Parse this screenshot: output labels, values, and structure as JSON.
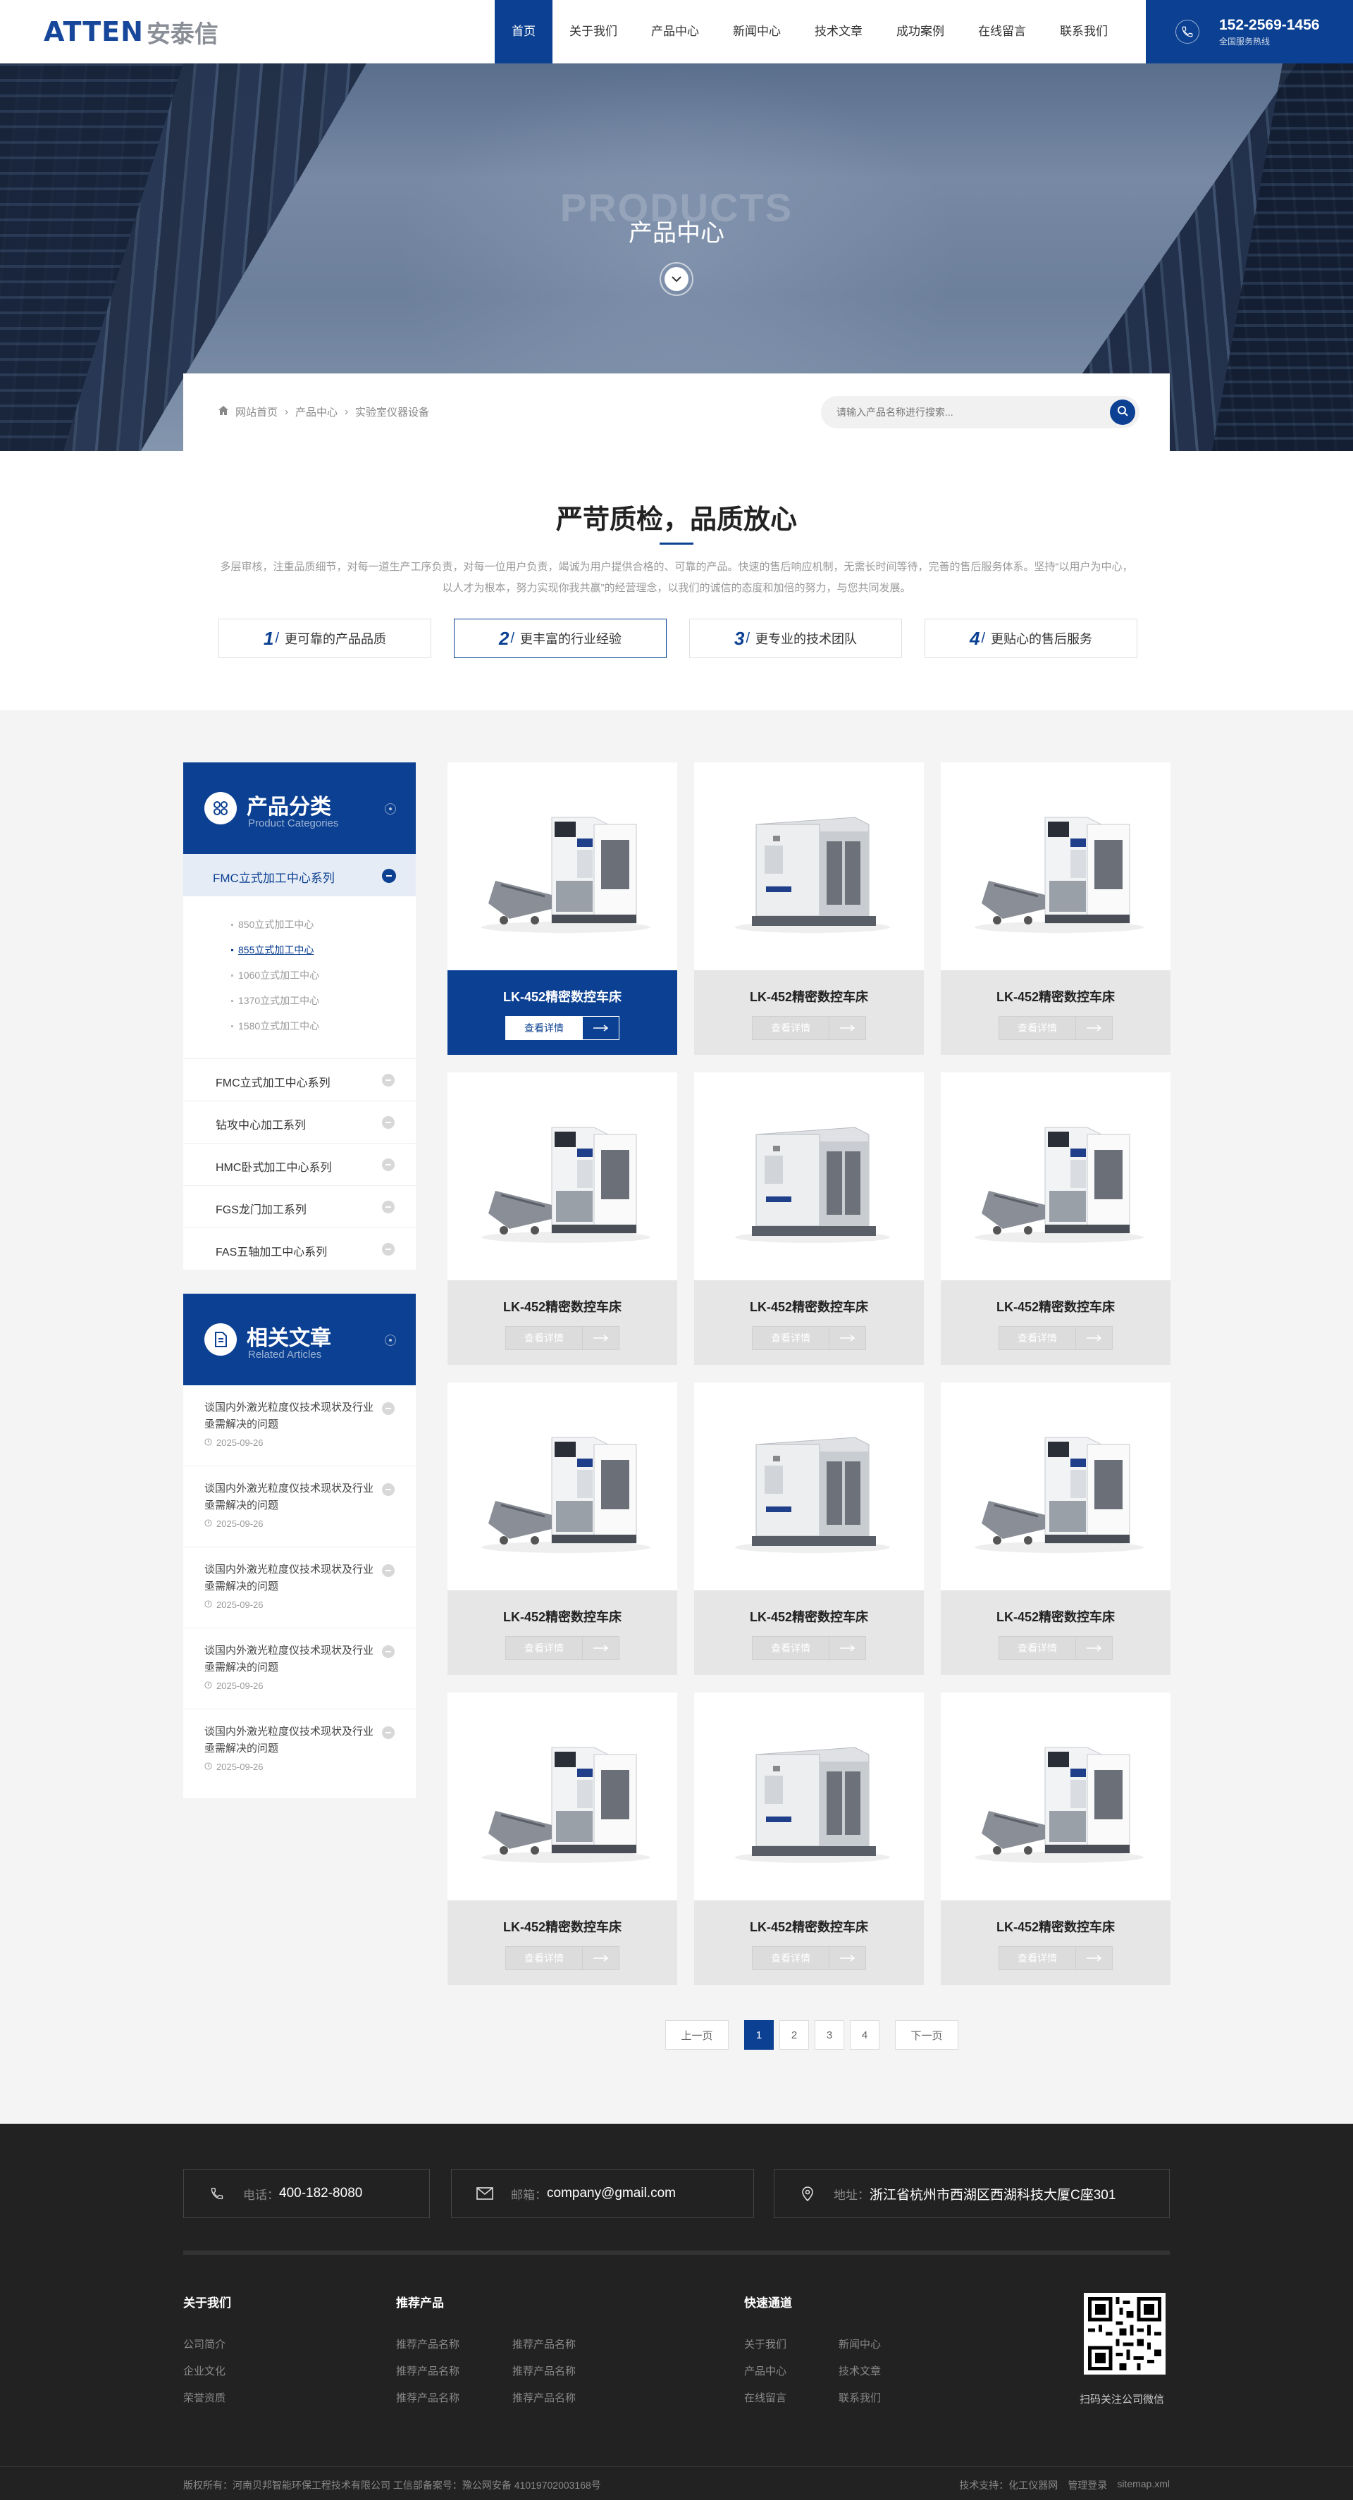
{
  "header": {
    "logo_en": "ATTEN",
    "logo_cn": "安泰信",
    "nav": [
      "首页",
      "关于我们",
      "产品中心",
      "新闻中心",
      "技术文章",
      "成功案例",
      "在线留言",
      "联系我们"
    ],
    "phone": "152-2569-1456",
    "phone_sub": "全国服务热线"
  },
  "banner": {
    "en": "PRODUCTS",
    "cn": "产品中心"
  },
  "breadcrumb": [
    "网站首页",
    "产品中心",
    "实验室仪器设备"
  ],
  "search": {
    "placeholder": "请输入产品名称进行搜索..."
  },
  "quality": {
    "title": "严苛质检，品质放心",
    "desc": "多层审核，注重品质细节，对每一道生产工序负责，对每一位用户负责，竭诚为用户提供合格的、可靠的产品。快速的售后响应机制，无需长时间等待，完善的售后服务体系。坚持“以用户为中心，以人才为根本，努力实现你我共赢”的经营理念，以我们的诚信的态度和加倍的努力，与您共同发展。",
    "items": [
      {
        "num": "1",
        "label": "更可靠的产品品质"
      },
      {
        "num": "2",
        "label": "更丰富的行业经验"
      },
      {
        "num": "3",
        "label": "更专业的技术团队"
      },
      {
        "num": "4",
        "label": "更贴心的售后服务"
      }
    ]
  },
  "sidebar": {
    "cat_title": "产品分类",
    "cat_sub": "Product Categories",
    "active_cat": "FMC立式加工中心系列",
    "sub_items": [
      "850立式加工中心",
      "855立式加工中心",
      "1060立式加工中心",
      "1370立式加工中心",
      "1580立式加工中心"
    ],
    "cats": [
      "FMC立式加工中心系列",
      "钻攻中心加工系列",
      "HMC卧式加工中心系列",
      "FGS龙门加工系列",
      "FAS五轴加工中心系列"
    ],
    "art_title": "相关文章",
    "art_sub": "Related Articles",
    "articles": [
      {
        "title": "谈国内外激光粒度仪技术现状及行业亟需解决的问题",
        "date": "2025-09-26"
      },
      {
        "title": "谈国内外激光粒度仪技术现状及行业亟需解决的问题",
        "date": "2025-09-26"
      },
      {
        "title": "谈国内外激光粒度仪技术现状及行业亟需解决的问题",
        "date": "2025-09-26"
      },
      {
        "title": "谈国内外激光粒度仪技术现状及行业亟需解决的问题",
        "date": "2025-09-26"
      },
      {
        "title": "谈国内外激光粒度仪技术现状及行业亟需解决的问题",
        "date": "2025-09-26"
      }
    ]
  },
  "products": {
    "name": "LK-452精密数控车床",
    "button": "查看详情"
  },
  "pager": {
    "prev": "上一页",
    "pages": [
      "1",
      "2",
      "3",
      "4"
    ],
    "next": "下一页"
  },
  "footer": {
    "tel_label": "电话：",
    "tel": "400-182-8080",
    "mail_label": "邮箱：",
    "mail": "company@gmail.com",
    "addr_label": "地址：",
    "addr": "浙江省杭州市西湖区西湖科技大厦C座301",
    "col1_title": "关于我们",
    "col1": [
      "公司简介",
      "企业文化",
      "荣誉资质"
    ],
    "col2_title": "推荐产品",
    "col2": [
      "推荐产品名称",
      "推荐产品名称",
      "推荐产品名称",
      "推荐产品名称",
      "推荐产品名称",
      "推荐产品名称"
    ],
    "col3_title": "快速通道",
    "col3": [
      "关于我们",
      "新闻中心",
      "产品中心",
      "技术文章",
      "在线留言",
      "联系我们"
    ],
    "qr_caption": "扫码关注公司微信",
    "copyright": "版权所有：河南贝邦智能环保工程技术有限公司 工信部备案号：豫公网安备 41019702003168号",
    "support": "技术支持：化工仪器网",
    "admin": "管理登录",
    "sitemap": "sitemap.xml"
  },
  "colors": {
    "brand": "#0b4092",
    "footer_bg": "#222222",
    "main_bg": "#f4f4f4"
  }
}
